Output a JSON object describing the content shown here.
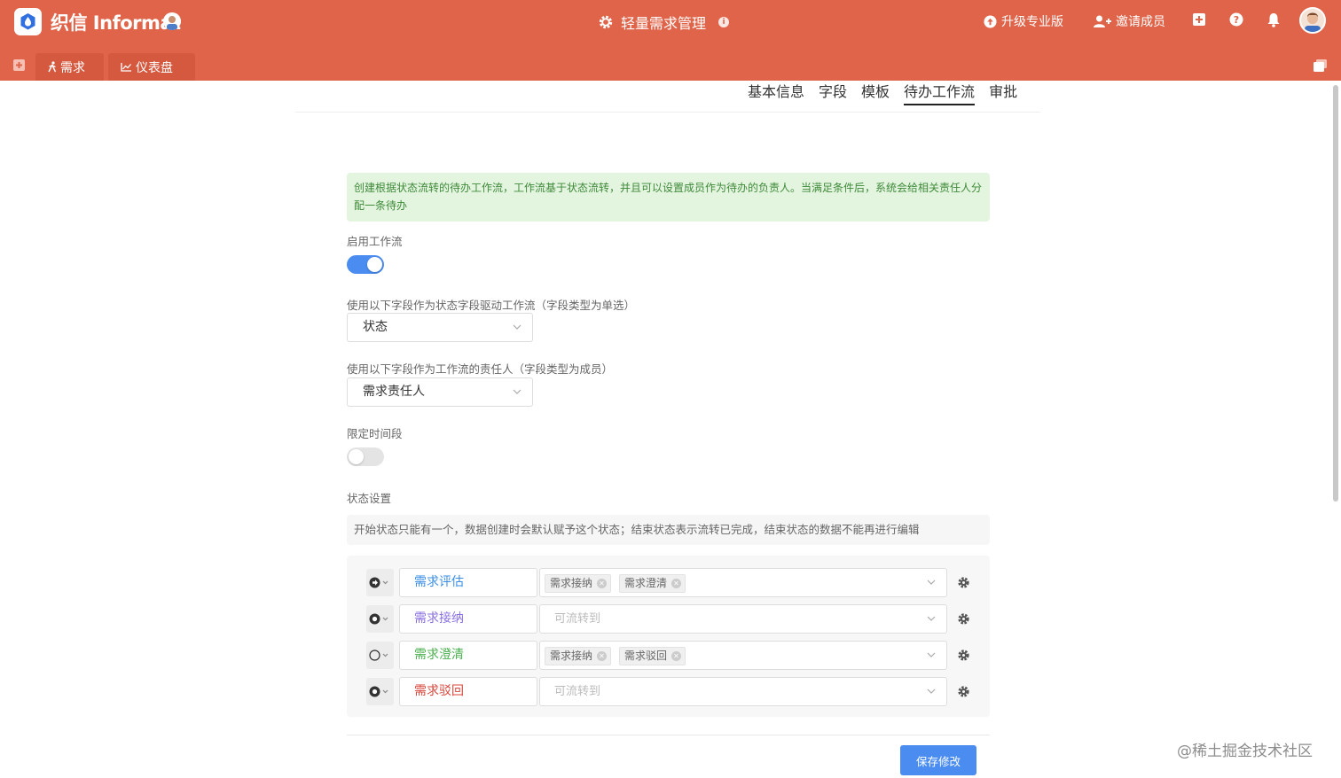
{
  "brand": {
    "name": "织信 Informat"
  },
  "app": {
    "title": "轻量需求管理"
  },
  "header_actions": {
    "upgrade": "升级专业版",
    "invite": "邀请成员"
  },
  "nav_tabs": [
    {
      "label": "需求",
      "icon": "person-run-icon"
    },
    {
      "label": "仪表盘",
      "icon": "line-chart-icon"
    }
  ],
  "settings_tabs": [
    "基本信息",
    "字段",
    "模板",
    "待办工作流",
    "审批"
  ],
  "active_settings_tab": "待办工作流",
  "notice": "创建根据状态流转的待办工作流，工作流基于状态流转，并且可以设置成员作为待办的负责人。当满足条件后，系统会给相关责任人分配一条待办",
  "workflow": {
    "enable_label": "启用工作流",
    "enabled": true,
    "status_field_label": "使用以下字段作为状态字段驱动工作流（字段类型为单选）",
    "status_field_value": "状态",
    "owner_field_label": "使用以下字段作为工作流的责任人（字段类型为成员）",
    "owner_field_value": "需求责任人",
    "time_limit_label": "限定时间段",
    "time_limit_enabled": false,
    "status_settings_label": "状态设置",
    "status_hint": "开始状态只能有一个，数据创建时会默认赋予这个状态；结束状态表示流转已完成，结束状态的数据不能再进行编辑",
    "placeholder": "可流转到",
    "statuses": [
      {
        "name": "需求评估",
        "color": "#3a8ee6",
        "icon": "start-arrow-icon",
        "targets": [
          "需求接纳",
          "需求澄清"
        ]
      },
      {
        "name": "需求接纳",
        "color": "#8a6fe0",
        "icon": "end-dot-icon",
        "targets": []
      },
      {
        "name": "需求澄清",
        "color": "#4cb050",
        "icon": "circle-outline-icon",
        "targets": [
          "需求接纳",
          "需求驳回"
        ]
      },
      {
        "name": "需求驳回",
        "color": "#d9453a",
        "icon": "end-dot-icon",
        "targets": []
      }
    ]
  },
  "save_label": "保存修改",
  "watermark": "@稀土掘金技术社区",
  "colors": {
    "header": "#e0644a",
    "primary": "#4a8cf0",
    "notice_bg": "#e3f4df",
    "notice_text": "#3f8a3a"
  }
}
